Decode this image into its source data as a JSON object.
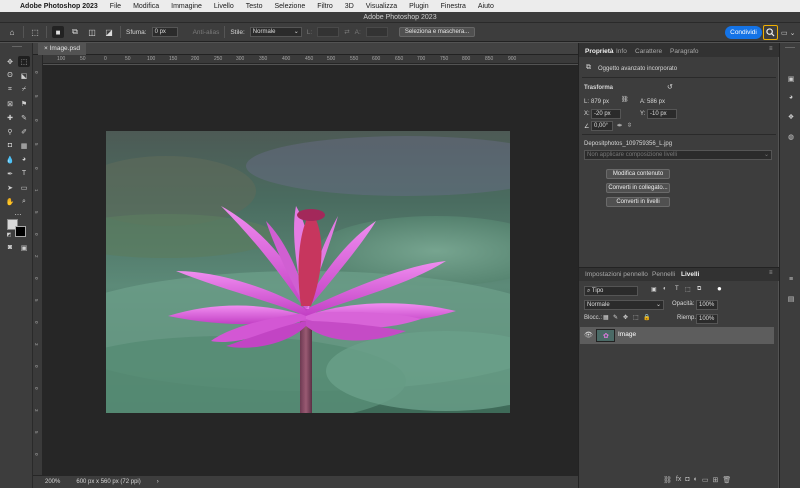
{
  "menubar": {
    "apple_icon": "apple-icon",
    "app_name": "Adobe Photoshop 2023",
    "items": [
      "File",
      "Modifica",
      "Immagine",
      "Livello",
      "Testo",
      "Selezione",
      "Filtro",
      "3D",
      "Visualizza",
      "Plugin",
      "Finestra",
      "Aiuto"
    ]
  },
  "window": {
    "title": "Adobe Photoshop 2023"
  },
  "options_bar": {
    "feather_label": "Sfuma:",
    "feather_value": "0 px",
    "antialias_label": "Anti-alias",
    "style_label": "Stile:",
    "style_value": "Normale",
    "width_label": "L:",
    "height_label": "A:",
    "select_mask_label": "Seleziona e maschera...",
    "share_label": "Condividi"
  },
  "document": {
    "tab_label": "Image.psd",
    "zoom": "200%",
    "info": "600 px x 560 px (72 ppi)"
  },
  "ruler": {
    "top": [
      "100",
      "50",
      "0",
      "50",
      "100",
      "150",
      "200",
      "250",
      "300",
      "350",
      "400",
      "450",
      "500",
      "550",
      "600",
      "650",
      "700",
      "750",
      "800",
      "850",
      "900"
    ],
    "left": [
      "0",
      "5",
      "0",
      "5",
      "0",
      "1",
      "5",
      "0",
      "2",
      "0",
      "5",
      "0",
      "3",
      "0",
      "0",
      "3",
      "5",
      "0"
    ]
  },
  "properties": {
    "tabs": [
      "Proprietà",
      "Info",
      "Carattere",
      "Paragrafo"
    ],
    "object_type": "Oggetto avanzato incorporato",
    "transform_title": "Trasforma",
    "w_label": "L:",
    "w_value": "879 px",
    "h_label": "A:",
    "h_value": "586 px",
    "x_label": "X:",
    "x_value": "-20 px",
    "y_label": "Y:",
    "y_value": "-10 px",
    "angle_value": "0,00°",
    "filename": "Depositphotos_109759356_L.jpg",
    "layer_comp": "Non applicare composizione livelli",
    "buttons": [
      "Modifica contenuto",
      "Converti in collegato...",
      "Converti in livelli"
    ]
  },
  "layers": {
    "tabs": [
      "Impostazioni pennello",
      "Pennelli",
      "Livelli"
    ],
    "filter_value": "Tipo",
    "blend_mode": "Normale",
    "opacity_label": "Opacità:",
    "opacity_value": "100%",
    "lock_label": "Blocc.:",
    "fill_label": "Riemp.:",
    "fill_value": "100%",
    "layer_name": "Image"
  },
  "colors": {
    "accent": "#1473e6",
    "search_highlight": "#f0b000",
    "foreground": "#000000",
    "background": "#ffffff"
  }
}
